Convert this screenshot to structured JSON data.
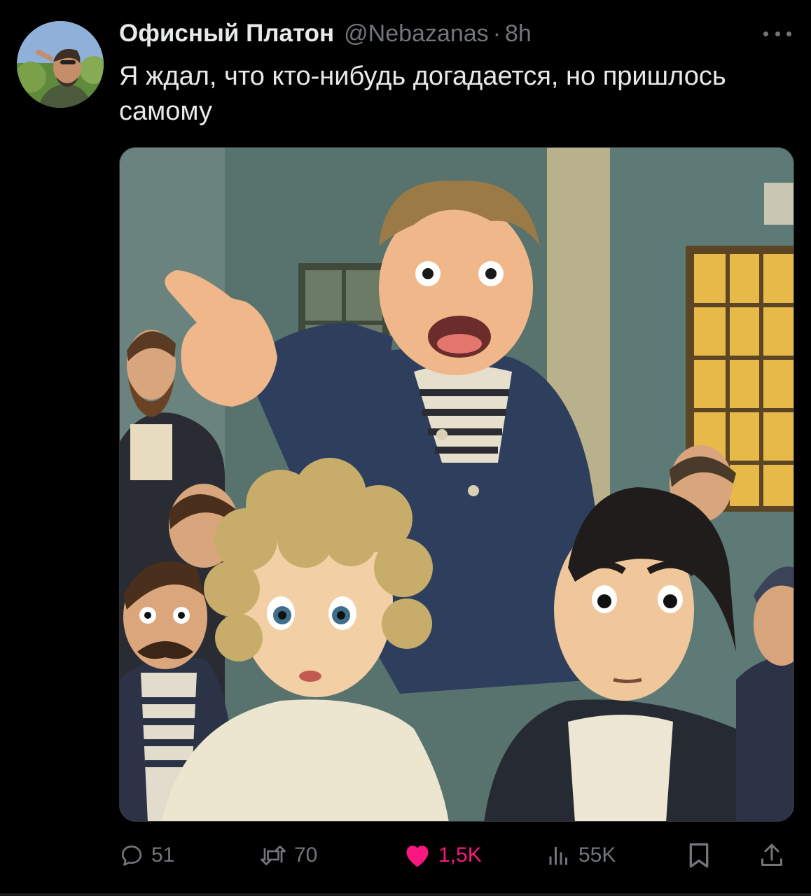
{
  "tweet": {
    "author_name": "Офисный Платон",
    "handle": "@Nebazanas",
    "separator": "·",
    "time": "8h",
    "text": "Я ждал, что кто-нибудь догадается, но пришлось самому",
    "media_alt": "Anime-style illustration of a man in a striped sailor shirt pointing, with a crowd around him"
  },
  "actions": {
    "replies": "51",
    "reposts": "70",
    "likes": "1,5K",
    "views": "55K"
  },
  "colors": {
    "background": "#000000",
    "text_primary": "#e7e9ea",
    "text_secondary": "#71767b",
    "like_active": "#f91880"
  },
  "icons": [
    "more-icon",
    "reply-icon",
    "repost-icon",
    "like-icon",
    "views-icon",
    "bookmark-icon",
    "share-icon"
  ]
}
